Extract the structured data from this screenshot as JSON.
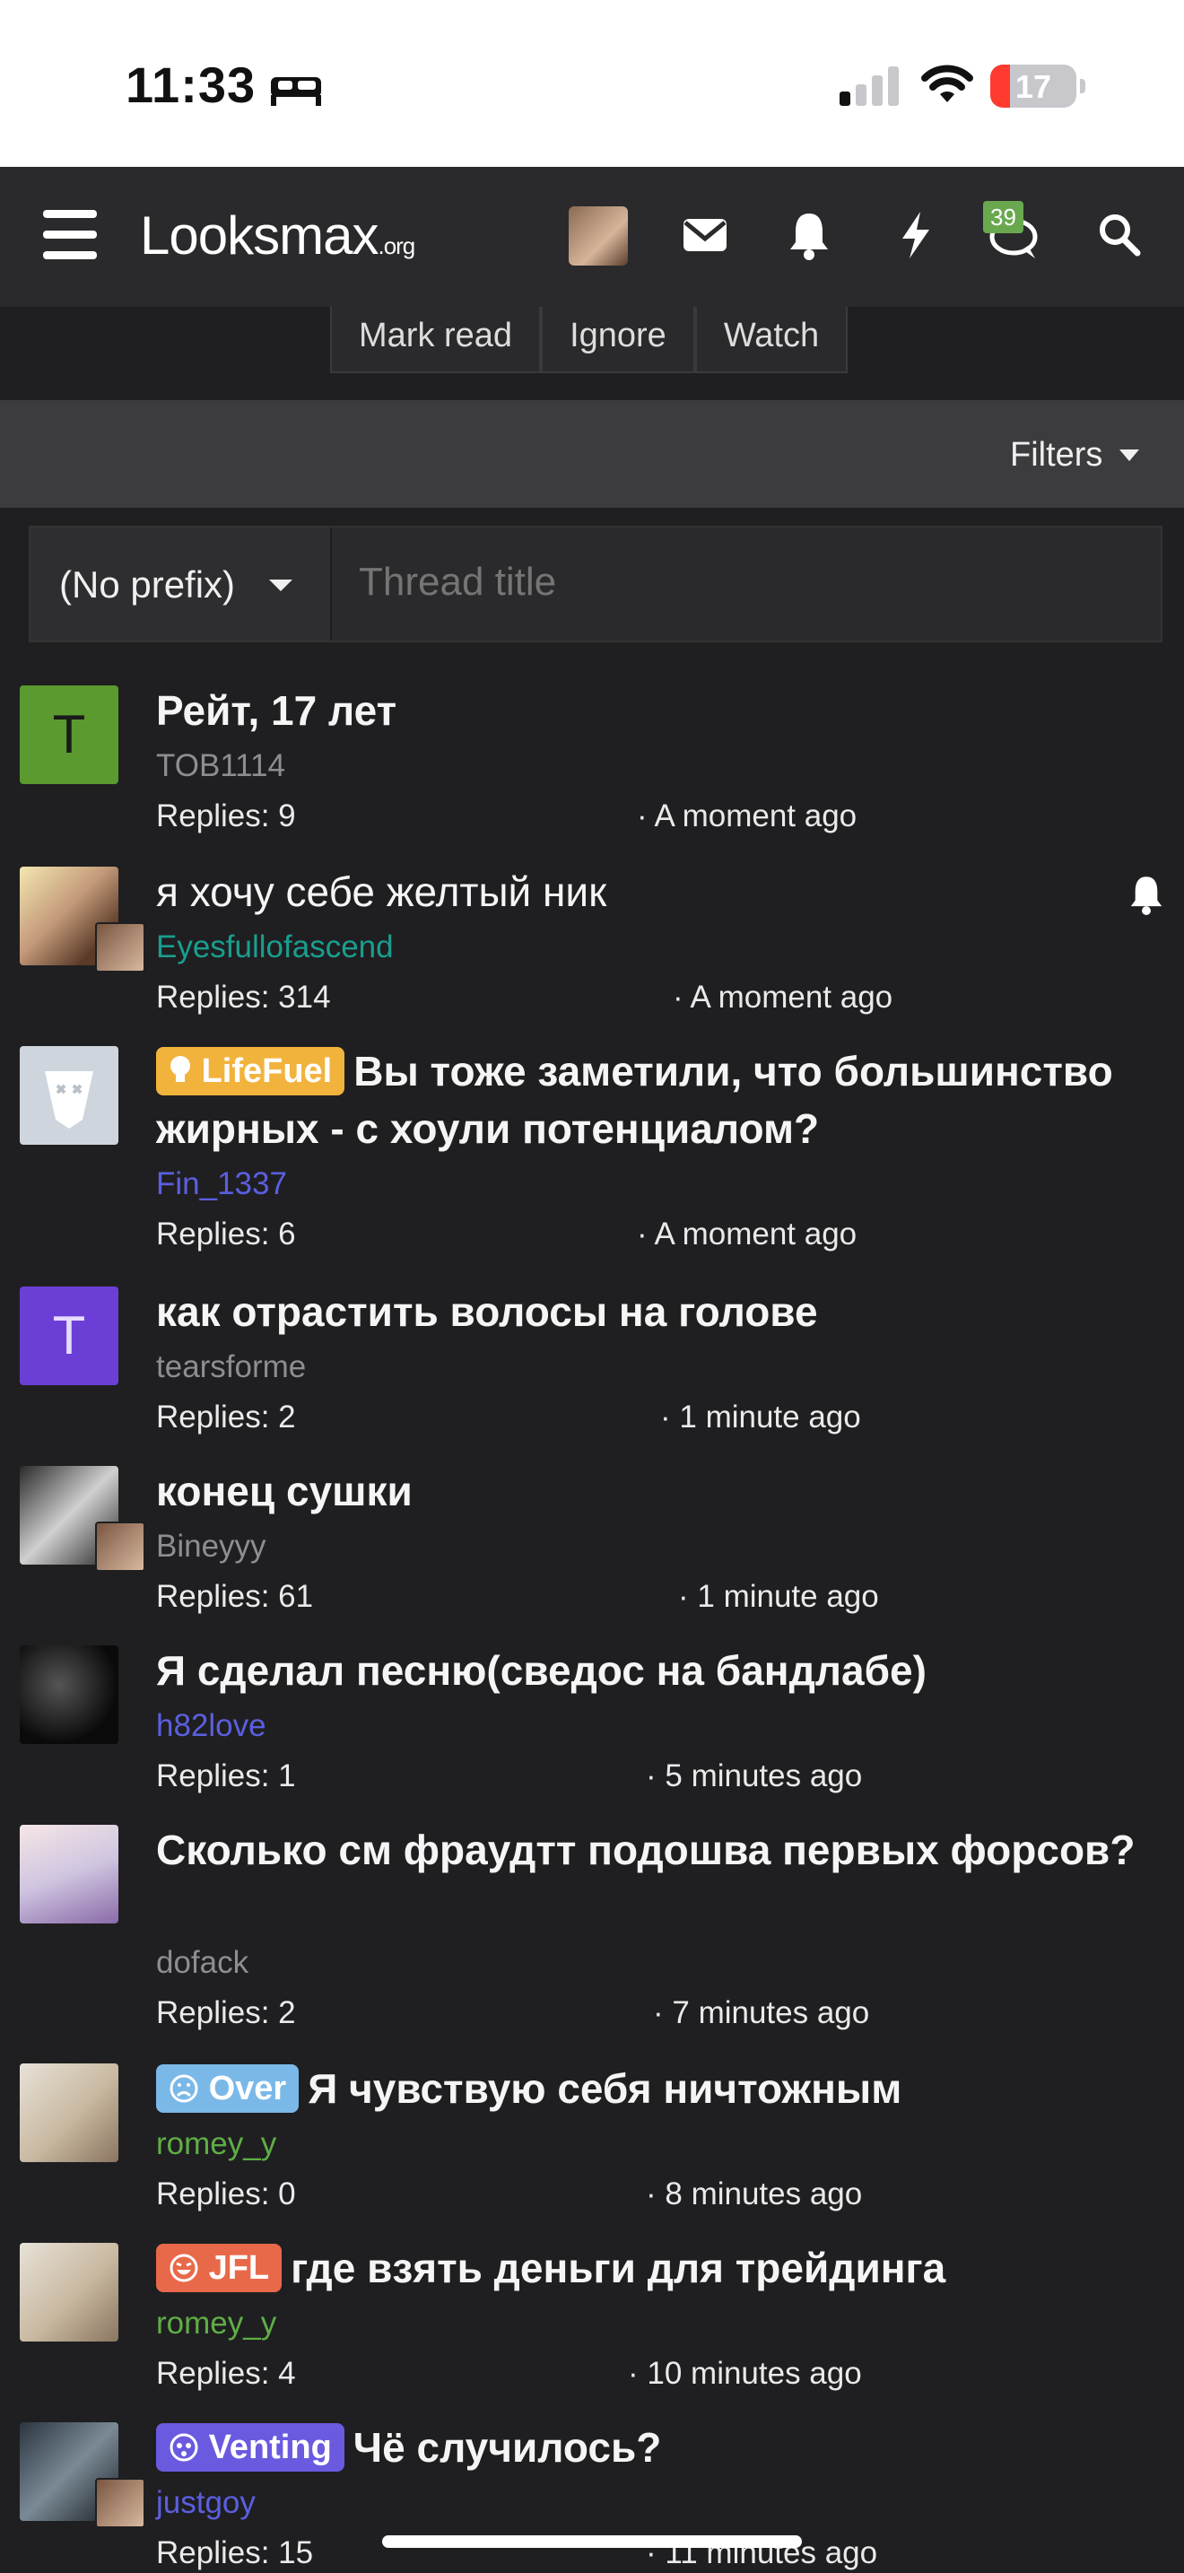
{
  "status": {
    "time": "11:33",
    "battery": "17"
  },
  "header": {
    "logo": "Looksmax",
    "logo_suffix": ".org",
    "chat_count": "39"
  },
  "actions": [
    "Mark read",
    "Ignore",
    "Watch"
  ],
  "filters_label": "Filters",
  "prefix_select": "(No prefix)",
  "title_placeholder": "Thread title",
  "colors": {
    "bg": "#1f1f21",
    "header": "#2a2a2c",
    "teal": "#1a9e8e",
    "blue": "#5b5fe0",
    "green": "#5fae45",
    "grey": "#8e8e90"
  },
  "threads": [
    {
      "title": "Рейт, 17 лет",
      "author": "TOB1114",
      "replies": "Replies: 9",
      "ago": "· A moment ago"
    },
    {
      "title": "я хочу себе желтый ник",
      "author": "Eyesfullofascend",
      "replies": "Replies: 314",
      "ago": "· A moment ago"
    },
    {
      "prefix": "LifeFuel",
      "title": "Вы тоже заметили, что большинство жирных - с хоули потенциалом?",
      "author": "Fin_1337",
      "replies": "Replies: 6",
      "ago": "· A moment ago"
    },
    {
      "title": "как отрастить волосы на голове",
      "author": "tearsforme",
      "replies": "Replies: 2",
      "ago": "· 1 minute ago"
    },
    {
      "title": "конец сушки",
      "author": "Bineyyy",
      "replies": "Replies: 61",
      "ago": "· 1 minute ago"
    },
    {
      "title": "Я сделал песню(сведос на бандлабе)",
      "author": "h82love",
      "replies": "Replies: 1",
      "ago": "· 5 minutes ago"
    },
    {
      "title": "Сколько см фраудтт подошва первых форсов?",
      "author": "dofack",
      "replies": "Replies: 2",
      "ago": "· 7 minutes ago"
    },
    {
      "prefix": "Over",
      "title": "Я чувствую себя ничтожным",
      "author": "romey_y",
      "replies": "Replies: 0",
      "ago": "· 8 minutes ago"
    },
    {
      "prefix": "JFL",
      "title": "где взять деньги для трейдинга",
      "author": "romey_y",
      "replies": "Replies: 4",
      "ago": "· 10 minutes ago"
    },
    {
      "prefix": "Venting",
      "title": "Чё случилось?",
      "author": "justgoy",
      "replies": "Replies: 15",
      "ago": "· 11 minutes ago"
    }
  ],
  "avatar_letters": {
    "t1": "T",
    "t4": "T"
  }
}
